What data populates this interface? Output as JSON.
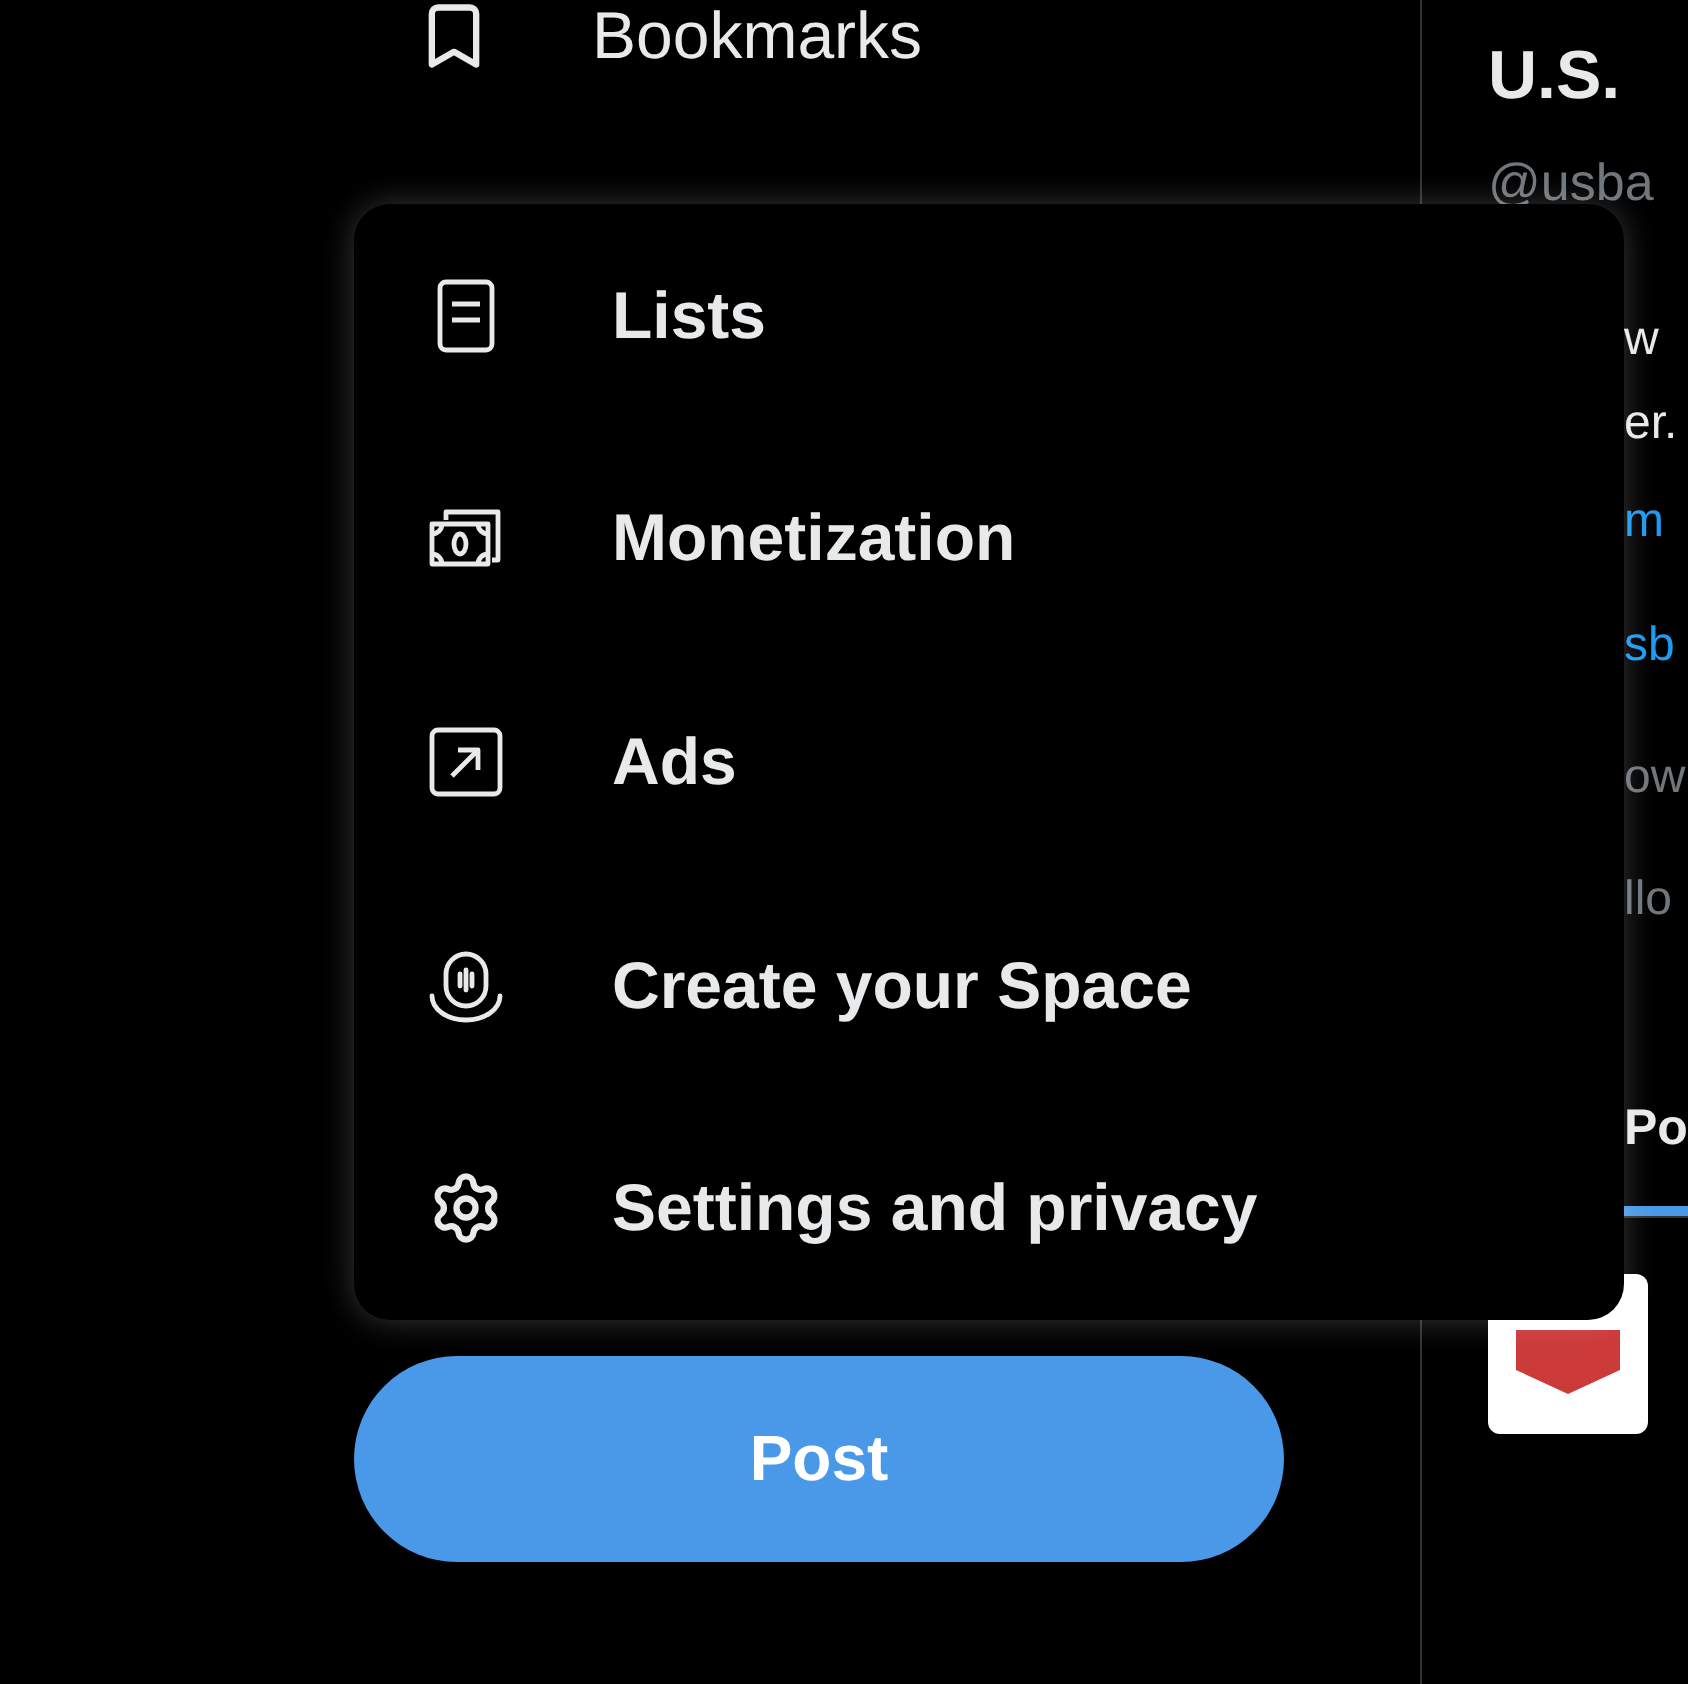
{
  "sidebar": {
    "items": [
      {
        "label": "Bookmarks"
      }
    ]
  },
  "menu": {
    "items": [
      {
        "label": "Lists"
      },
      {
        "label": "Monetization"
      },
      {
        "label": "Ads"
      },
      {
        "label": "Create your Space"
      },
      {
        "label": "Settings and privacy"
      }
    ]
  },
  "post_button": {
    "label": "Post"
  },
  "profile": {
    "name": "U.S.",
    "handle": "@usba",
    "bio_lines": [
      "w",
      "er."
    ],
    "links": [
      "m",
      "sb"
    ],
    "stats": [
      "ow",
      "llo"
    ],
    "tabs": [
      {
        "label": "Po",
        "selected": true
      }
    ]
  }
}
